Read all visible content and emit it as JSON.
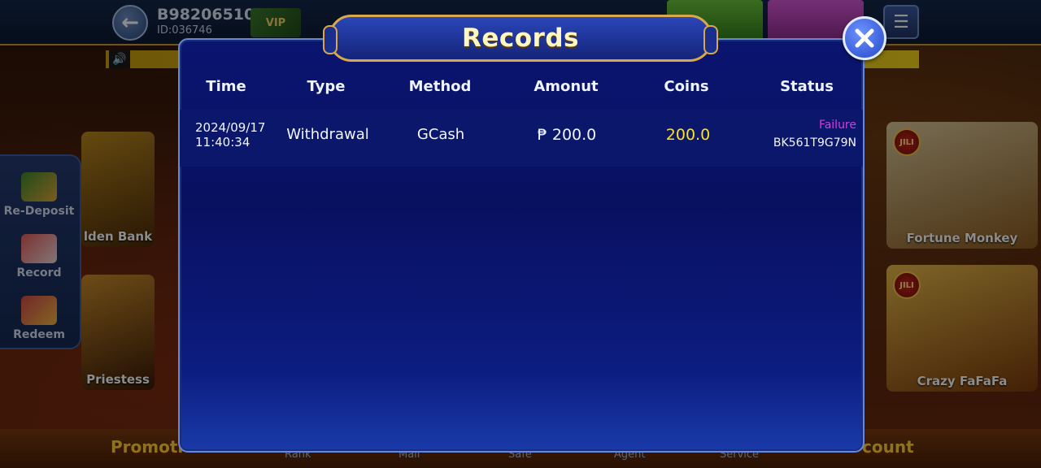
{
  "player": {
    "name": "B98206510",
    "id": "ID:036746",
    "vip": "VIP"
  },
  "side_menu": [
    {
      "label": "Re-Deposit"
    },
    {
      "label": "Record"
    },
    {
      "label": "Redeem"
    }
  ],
  "games": {
    "left_top": "lden Bank",
    "left_bottom": "Priestess",
    "right_top": "Fortune Monkey",
    "right_bottom": "Crazy FaFaFa",
    "badge": "JILI"
  },
  "bottom_nav": {
    "promo": "Promoti",
    "discount": "count",
    "items": [
      "Rank",
      "Mail",
      "Safe",
      "Agent",
      "Service"
    ]
  },
  "records": {
    "title": "Records",
    "columns": [
      "Time",
      "Type",
      "Method",
      "Amonut",
      "Coins",
      "Status"
    ],
    "rows": [
      {
        "date": "2024/09/17",
        "time": "11:40:34",
        "type": "Withdrawal",
        "method": "GCash",
        "amount": "₱ 200.0",
        "coins": "200.0",
        "status": "Failure",
        "order_no": "BK561T9G79N"
      }
    ]
  },
  "colors": {
    "status_failure": "#d63ce0",
    "coins": "#ffe21a",
    "title": "#fff7c2",
    "modal_bg": "#0a1570"
  },
  "icons": {
    "close": "close-icon",
    "back": "back-arrow-icon",
    "menu": "hamburger-menu-icon",
    "speaker": "speaker-icon"
  }
}
